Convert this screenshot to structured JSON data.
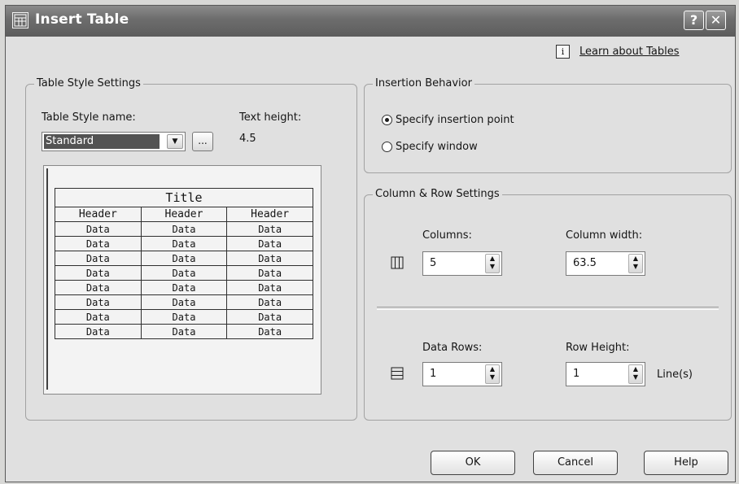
{
  "window": {
    "title": "Insert Table"
  },
  "titlebar": {
    "help_glyph": "?",
    "close_glyph": "✕"
  },
  "learn_link": "Learn about Tables",
  "table_style": {
    "group_title": "Table Style Settings",
    "name_label": "Table Style name:",
    "name_value": "Standard",
    "text_height_label": "Text height:",
    "text_height_value": "4.5",
    "browse_label": "..."
  },
  "preview": {
    "title": "Title",
    "headers": [
      "Header",
      "Header",
      "Header"
    ],
    "rows": [
      [
        "Data",
        "Data",
        "Data"
      ],
      [
        "Data",
        "Data",
        "Data"
      ],
      [
        "Data",
        "Data",
        "Data"
      ],
      [
        "Data",
        "Data",
        "Data"
      ],
      [
        "Data",
        "Data",
        "Data"
      ],
      [
        "Data",
        "Data",
        "Data"
      ],
      [
        "Data",
        "Data",
        "Data"
      ],
      [
        "Data",
        "Data",
        "Data"
      ]
    ]
  },
  "insertion": {
    "group_title": "Insertion Behavior",
    "option_point": "Specify insertion point",
    "option_window": "Specify window",
    "selected": "point"
  },
  "colrow": {
    "group_title": "Column & Row Settings",
    "columns_label": "Columns:",
    "columns_value": "5",
    "col_width_label": "Column width:",
    "col_width_value": "63.5",
    "data_rows_label": "Data Rows:",
    "data_rows_value": "1",
    "row_height_label": "Row Height:",
    "row_height_value": "1",
    "row_height_unit": "Line(s)"
  },
  "buttons": {
    "ok": "OK",
    "cancel": "Cancel",
    "help": "Help"
  },
  "icons": {
    "app": "table-icon",
    "info": "info-icon",
    "columns": "columns-icon",
    "rows": "rows-icon"
  }
}
